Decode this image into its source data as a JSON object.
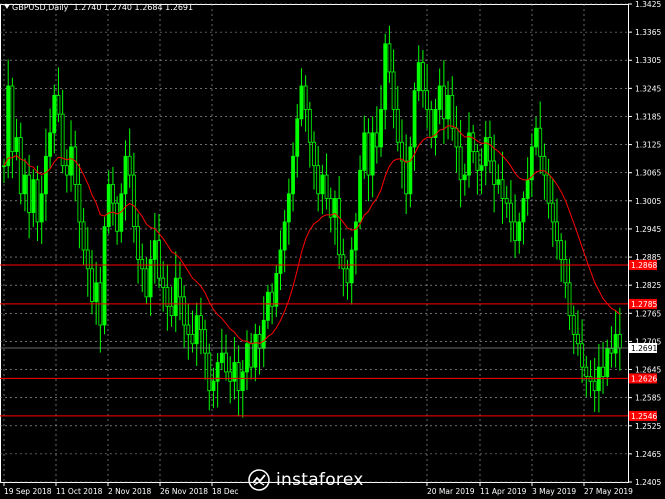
{
  "header": {
    "symbol_timeframe": "GBPUSD,Daily",
    "ohlc": "1.2740 1.2740 1.2684 1.2691"
  },
  "watermark": {
    "text": "instaforex",
    "icon": "instaforex-logo-icon"
  },
  "chart_data": {
    "type": "candlestick",
    "title": "GBPUSD,Daily",
    "ylim": [
      1.2405,
      1.3425
    ],
    "y_ticks": [
      "1.3425",
      "1.3365",
      "1.3305",
      "1.3245",
      "1.3185",
      "1.3125",
      "1.3065",
      "1.3005",
      "1.2945",
      "1.2885",
      "1.2825",
      "1.2765",
      "1.2705",
      "1.2645",
      "1.2585",
      "1.2525",
      "1.2465",
      "1.2405"
    ],
    "x_ticks": [
      "19 Sep 2018",
      "11 Oct 2018",
      "2 Nov 2018",
      "26 Nov 2018",
      "18 Dec",
      "20 Mar 2019",
      "11 Apr 2019",
      "3 May 2019",
      "27 May 2019"
    ],
    "grid": true,
    "current_price": {
      "value": 1.2691,
      "label": "1.2691"
    },
    "horizontal_levels": [
      {
        "value": 1.2868,
        "label": "1.2868"
      },
      {
        "value": 1.2785,
        "label": "1.2785"
      },
      {
        "value": 1.2626,
        "label": "1.2626"
      },
      {
        "value": 1.2546,
        "label": "1.2546"
      }
    ],
    "close_series": [
      1.308,
      1.325,
      1.311,
      1.314,
      1.302,
      1.306,
      1.298,
      1.305,
      1.296,
      1.302,
      1.31,
      1.315,
      1.323,
      1.319,
      1.308,
      1.306,
      1.312,
      1.304,
      1.296,
      1.29,
      1.286,
      1.279,
      1.283,
      1.274,
      1.295,
      1.304,
      1.3,
      1.294,
      1.302,
      1.31,
      1.306,
      1.295,
      1.288,
      1.286,
      1.28,
      1.288,
      1.292,
      1.284,
      1.282,
      1.278,
      1.276,
      1.284,
      1.28,
      1.274,
      1.272,
      1.27,
      1.276,
      1.273,
      1.268,
      1.26,
      1.262,
      1.266,
      1.268,
      1.264,
      1.262,
      1.266,
      1.26,
      1.264,
      1.27,
      1.265,
      1.272,
      1.269,
      1.275,
      1.281,
      1.278,
      1.285,
      1.29,
      1.296,
      1.302,
      1.31,
      1.318,
      1.325,
      1.32,
      1.313,
      1.308,
      1.302,
      1.306,
      1.301,
      1.297,
      1.301,
      1.289,
      1.286,
      1.283,
      1.29,
      1.296,
      1.307,
      1.315,
      1.306,
      1.315,
      1.312,
      1.32,
      1.334,
      1.328,
      1.32,
      1.313,
      1.309,
      1.302,
      1.312,
      1.324,
      1.33,
      1.324,
      1.32,
      1.314,
      1.32,
      1.325,
      1.318,
      1.323,
      1.316,
      1.312,
      1.305,
      1.306,
      1.315,
      1.311,
      1.307,
      1.308,
      1.314,
      1.309,
      1.304,
      1.305,
      1.301,
      1.3,
      1.296,
      1.292,
      1.296,
      1.301,
      1.305,
      1.312,
      1.316,
      1.31,
      1.306,
      1.3,
      1.296,
      1.292,
      1.288,
      1.283,
      1.276,
      1.272,
      1.27,
      1.265,
      1.263,
      1.262,
      1.26,
      1.265,
      1.263,
      1.269,
      1.268,
      1.272,
      1.2691
    ]
  }
}
